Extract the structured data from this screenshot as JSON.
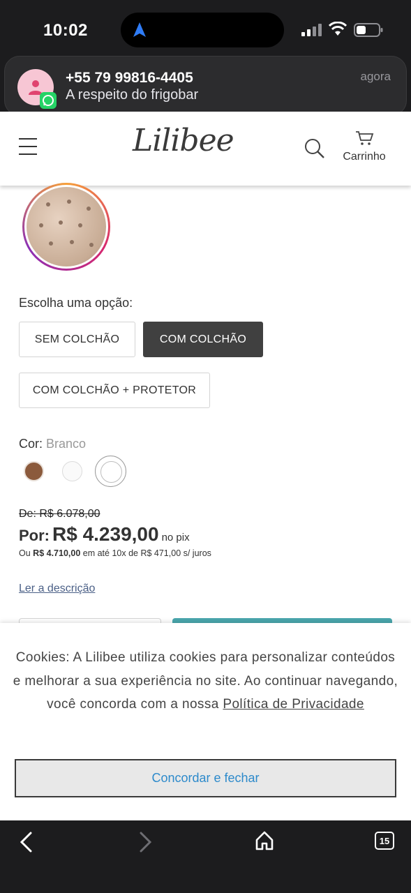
{
  "status_bar": {
    "time": "10:02"
  },
  "notification": {
    "title": "+55 79 99816-4405",
    "message": "A respeito do frigobar",
    "when": "agora",
    "app_icon": "whatsapp-icon"
  },
  "header": {
    "logo": "Lilibee",
    "cart_label": "Carrinho"
  },
  "product": {
    "choose_label": "Escolha uma opção:",
    "options": [
      "SEM COLCHÃO",
      "COM COLCHÃO",
      "COM COLCHÃO + PROTETOR"
    ],
    "selected_option": "COM COLCHÃO",
    "color_label": "Cor:",
    "color_value": "Branco",
    "swatch_colors": [
      "#8b5a3c",
      "#fafafa",
      "#ffffff"
    ],
    "price_old": "De: R$ 6.078,00",
    "price_prefix": "Por:",
    "price_now": "R$ 4.239,00",
    "price_suffix": "no pix",
    "installment_prefix": "Ou",
    "installment_total": "R$ 4.710,00",
    "installment_rest": "em até 10x de R$ 471,00 s/ juros",
    "read_description": "Ler a descrição"
  },
  "cookie": {
    "text": "Cookies: A Lilibee utiliza cookies para personalizar conteúdos e melhorar a sua experiência no site. Ao continuar navegando, você concorda com a nossa",
    "link": "Política de Privacidade",
    "button": "Concordar e fechar"
  },
  "browser_bar": {
    "tab_count": "15"
  },
  "colors": {
    "accent_teal": "#4aa7ad",
    "link_blue": "#2d8acb",
    "selected_option_bg": "#404040"
  }
}
